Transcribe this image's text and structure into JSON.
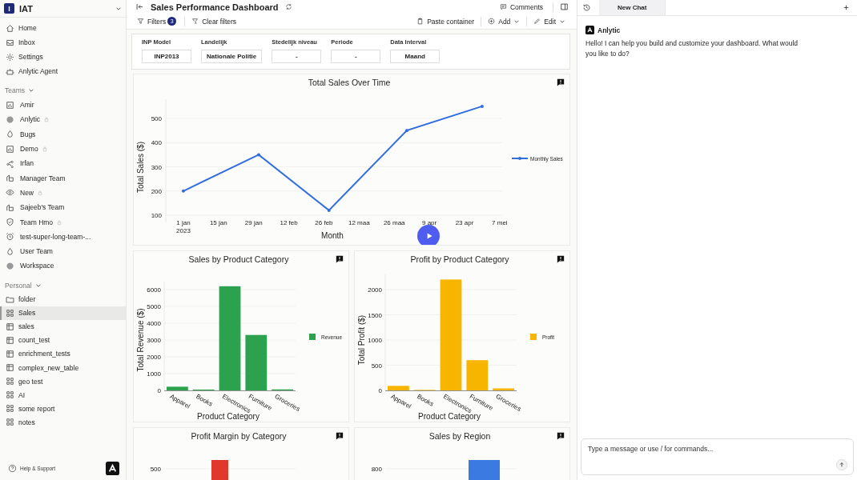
{
  "workspace": {
    "logo_letter": "I",
    "name": "IAT"
  },
  "nav": [
    {
      "label": "Home",
      "kind": "home",
      "selected": false
    },
    {
      "label": "Inbox",
      "kind": "inbox",
      "selected": false
    },
    {
      "label": "Settings",
      "kind": "gear",
      "selected": false
    },
    {
      "label": "Anlytic Agent",
      "kind": "robot",
      "selected": false
    }
  ],
  "teams": {
    "title": "Teams",
    "expanded": true,
    "items": [
      {
        "label": "Amir",
        "kind": "chart",
        "locked": false,
        "selected": false
      },
      {
        "label": "Anlytic",
        "kind": "blob",
        "locked": true,
        "selected": false
      },
      {
        "label": "Bugs",
        "kind": "flame",
        "locked": false,
        "selected": false
      },
      {
        "label": "Demo",
        "kind": "chart",
        "locked": true,
        "selected": false
      },
      {
        "label": "Irfan",
        "kind": "share",
        "locked": false,
        "selected": false
      },
      {
        "label": "Manager Team",
        "kind": "building",
        "locked": false,
        "selected": false
      },
      {
        "label": "New",
        "kind": "eye",
        "locked": true,
        "selected": false
      },
      {
        "label": "Sajeeb's Team",
        "kind": "building",
        "locked": false,
        "selected": false
      },
      {
        "label": "Team Hmo",
        "kind": "shield",
        "locked": true,
        "selected": false
      },
      {
        "label": "test-super-long-team-...",
        "kind": "alarm",
        "locked": false,
        "selected": false
      },
      {
        "label": "User Team",
        "kind": "flame",
        "locked": false,
        "selected": false
      },
      {
        "label": "Workspace",
        "kind": "blob",
        "locked": false,
        "selected": false
      }
    ]
  },
  "personal": {
    "title": "Personal",
    "expanded": true,
    "items": [
      {
        "label": "folder",
        "kind": "folder",
        "selected": false
      },
      {
        "label": "Sales",
        "kind": "grid",
        "selected": true
      },
      {
        "label": "sales",
        "kind": "table",
        "selected": false
      },
      {
        "label": "count_test",
        "kind": "table",
        "selected": false
      },
      {
        "label": "enrichment_tests",
        "kind": "table",
        "selected": false
      },
      {
        "label": "complex_new_table",
        "kind": "table",
        "selected": false
      },
      {
        "label": "geo test",
        "kind": "grid",
        "selected": false
      },
      {
        "label": "AI",
        "kind": "grid",
        "selected": false
      },
      {
        "label": "some report",
        "kind": "grid",
        "selected": false
      },
      {
        "label": "notes",
        "kind": "grid",
        "selected": false
      }
    ]
  },
  "help": "Help & Support",
  "dashboard": {
    "title": "Sales Performance Dashboard",
    "comments": "Comments",
    "filters_label": "Filters",
    "filters_count": "3",
    "clear_filters": "Clear filters",
    "paste": "Paste container",
    "add": "Add",
    "edit": "Edit"
  },
  "filters": [
    {
      "label": "INP Model",
      "value": "INP2013"
    },
    {
      "label": "Landelijk",
      "value": "Nationale Politie"
    },
    {
      "label": "Stedelijk niveau",
      "value": "-"
    },
    {
      "label": "Periode",
      "value": "-"
    },
    {
      "label": "Data Interval",
      "value": "Maand"
    }
  ],
  "line_panel": {
    "chart_data": {
      "type": "line",
      "title": "Total Sales Over Time",
      "xlabel": "Month",
      "ylabel": "Total Sales ($)",
      "x": [
        "2023-01-01",
        "2023-01-31",
        "2023-02-28",
        "2023-03-31",
        "2023-04-30"
      ],
      "series": [
        {
          "name": "Monthly Sales",
          "color": "#2f6de1",
          "values": [
            200,
            350,
            120,
            450,
            550
          ]
        }
      ],
      "xticks": [
        {
          "value": "2023-01-01",
          "label": "1 jan\n2023"
        },
        {
          "value": "2023-01-15",
          "label": "15 jan"
        },
        {
          "value": "2023-01-29",
          "label": "29 jan"
        },
        {
          "value": "2023-02-12",
          "label": "12 feb"
        },
        {
          "value": "2023-02-26",
          "label": "26 feb"
        },
        {
          "value": "2023-03-12",
          "label": "12 maa"
        },
        {
          "value": "2023-03-26",
          "label": "26 maa"
        },
        {
          "value": "2023-04-09",
          "label": "9 apr"
        },
        {
          "value": "2023-04-23",
          "label": "23 apr"
        },
        {
          "value": "2023-05-07",
          "label": "7 mei"
        }
      ],
      "xlim": [
        "2022-12-25",
        "2023-05-08"
      ],
      "yticks": [
        100,
        200,
        300,
        400,
        500
      ],
      "ylim": [
        70,
        580
      ],
      "grid": true
    }
  },
  "bar_panels": [
    {
      "chart_data": {
        "type": "bar",
        "title": "Sales by Product Category",
        "xlabel": "Product Category",
        "ylabel": "Total Revenue ($)",
        "categories": [
          "Apparel",
          "Books",
          "Electronics",
          "Furniture",
          "Groceries"
        ],
        "series": [
          {
            "name": "Revenue",
            "color": "#2ca24f",
            "values": [
              220,
              50,
              6200,
              3300,
              60
            ]
          }
        ],
        "yticks": [
          0,
          1000,
          2000,
          3000,
          4000,
          5000,
          6000
        ],
        "ylim": [
          0,
          6500
        ],
        "grid": true
      }
    },
    {
      "chart_data": {
        "type": "bar",
        "title": "Profit by Product Category",
        "xlabel": "Product Category",
        "ylabel": "Total Profit ($)",
        "categories": [
          "Apparel",
          "Books",
          "Electronics",
          "Furniture",
          "Groceries"
        ],
        "series": [
          {
            "name": "Profit",
            "color": "#f7b500",
            "values": [
              90,
              10,
              2200,
              600,
              40
            ]
          }
        ],
        "yticks": [
          0,
          500,
          1000,
          1500,
          2000
        ],
        "ylim": [
          0,
          2300
        ],
        "grid": true
      }
    }
  ],
  "cut_panels": [
    {
      "title": "Profit Margin by Category",
      "tick": "500",
      "color": "#e0382c"
    },
    {
      "title": "Sales by Region",
      "tick": "800",
      "color": "#3b7ae0"
    }
  ],
  "chat": {
    "tab": {
      "label": "New Chat",
      "selected": true
    },
    "sender": "Anlytic",
    "message": "Hello! I can help you build and customize your dashboard. What would you like to do?",
    "placeholder": "Type a message or use / for commands..."
  }
}
